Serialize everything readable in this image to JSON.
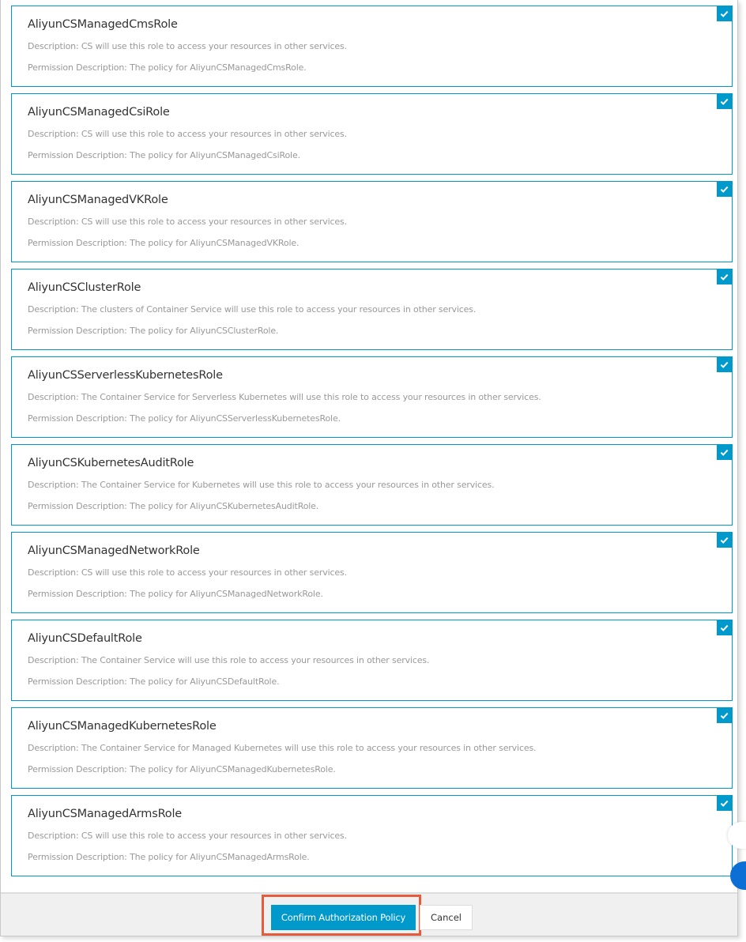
{
  "roles": [
    {
      "name": "AliyunCSManagedCmsRole",
      "description": "Description: CS will use this role to access your resources in other services.",
      "permission": "Permission Description: The policy for AliyunCSManagedCmsRole.",
      "checked": true
    },
    {
      "name": "AliyunCSManagedCsiRole",
      "description": "Description: CS will use this role to access your resources in other services.",
      "permission": "Permission Description: The policy for AliyunCSManagedCsiRole.",
      "checked": true
    },
    {
      "name": "AliyunCSManagedVKRole",
      "description": "Description: CS will use this role to access your resources in other services.",
      "permission": "Permission Description: The policy for AliyunCSManagedVKRole.",
      "checked": true
    },
    {
      "name": "AliyunCSClusterRole",
      "description": "Description: The clusters of Container Service will use this role to access your resources in other services.",
      "permission": "Permission Description: The policy for AliyunCSClusterRole.",
      "checked": true
    },
    {
      "name": "AliyunCSServerlessKubernetesRole",
      "description": "Description: The Container Service for Serverless Kubernetes will use this role to access your resources in other services.",
      "permission": "Permission Description: The policy for AliyunCSServerlessKubernetesRole.",
      "checked": true
    },
    {
      "name": "AliyunCSKubernetesAuditRole",
      "description": "Description: The Container Service for Kubernetes will use this role to access your resources in other services.",
      "permission": "Permission Description: The policy for AliyunCSKubernetesAuditRole.",
      "checked": true
    },
    {
      "name": "AliyunCSManagedNetworkRole",
      "description": "Description: CS will use this role to access your resources in other services.",
      "permission": "Permission Description: The policy for AliyunCSManagedNetworkRole.",
      "checked": true
    },
    {
      "name": "AliyunCSDefaultRole",
      "description": "Description: The Container Service will use this role to access your resources in other services.",
      "permission": "Permission Description: The policy for AliyunCSDefaultRole.",
      "checked": true
    },
    {
      "name": "AliyunCSManagedKubernetesRole",
      "description": "Description: The Container Service for Managed Kubernetes will use this role to access your resources in other services.",
      "permission": "Permission Description: The policy for AliyunCSManagedKubernetesRole.",
      "checked": true
    },
    {
      "name": "AliyunCSManagedArmsRole",
      "description": "Description: CS will use this role to access your resources in other services.",
      "permission": "Permission Description: The policy for AliyunCSManagedArmsRole.",
      "checked": true
    }
  ],
  "footer": {
    "confirm_label": "Confirm Authorization Policy",
    "cancel_label": "Cancel"
  },
  "colors": {
    "accent": "#0099cc",
    "highlight": "#e85a3c",
    "floating_button": "#0b6fd6"
  }
}
